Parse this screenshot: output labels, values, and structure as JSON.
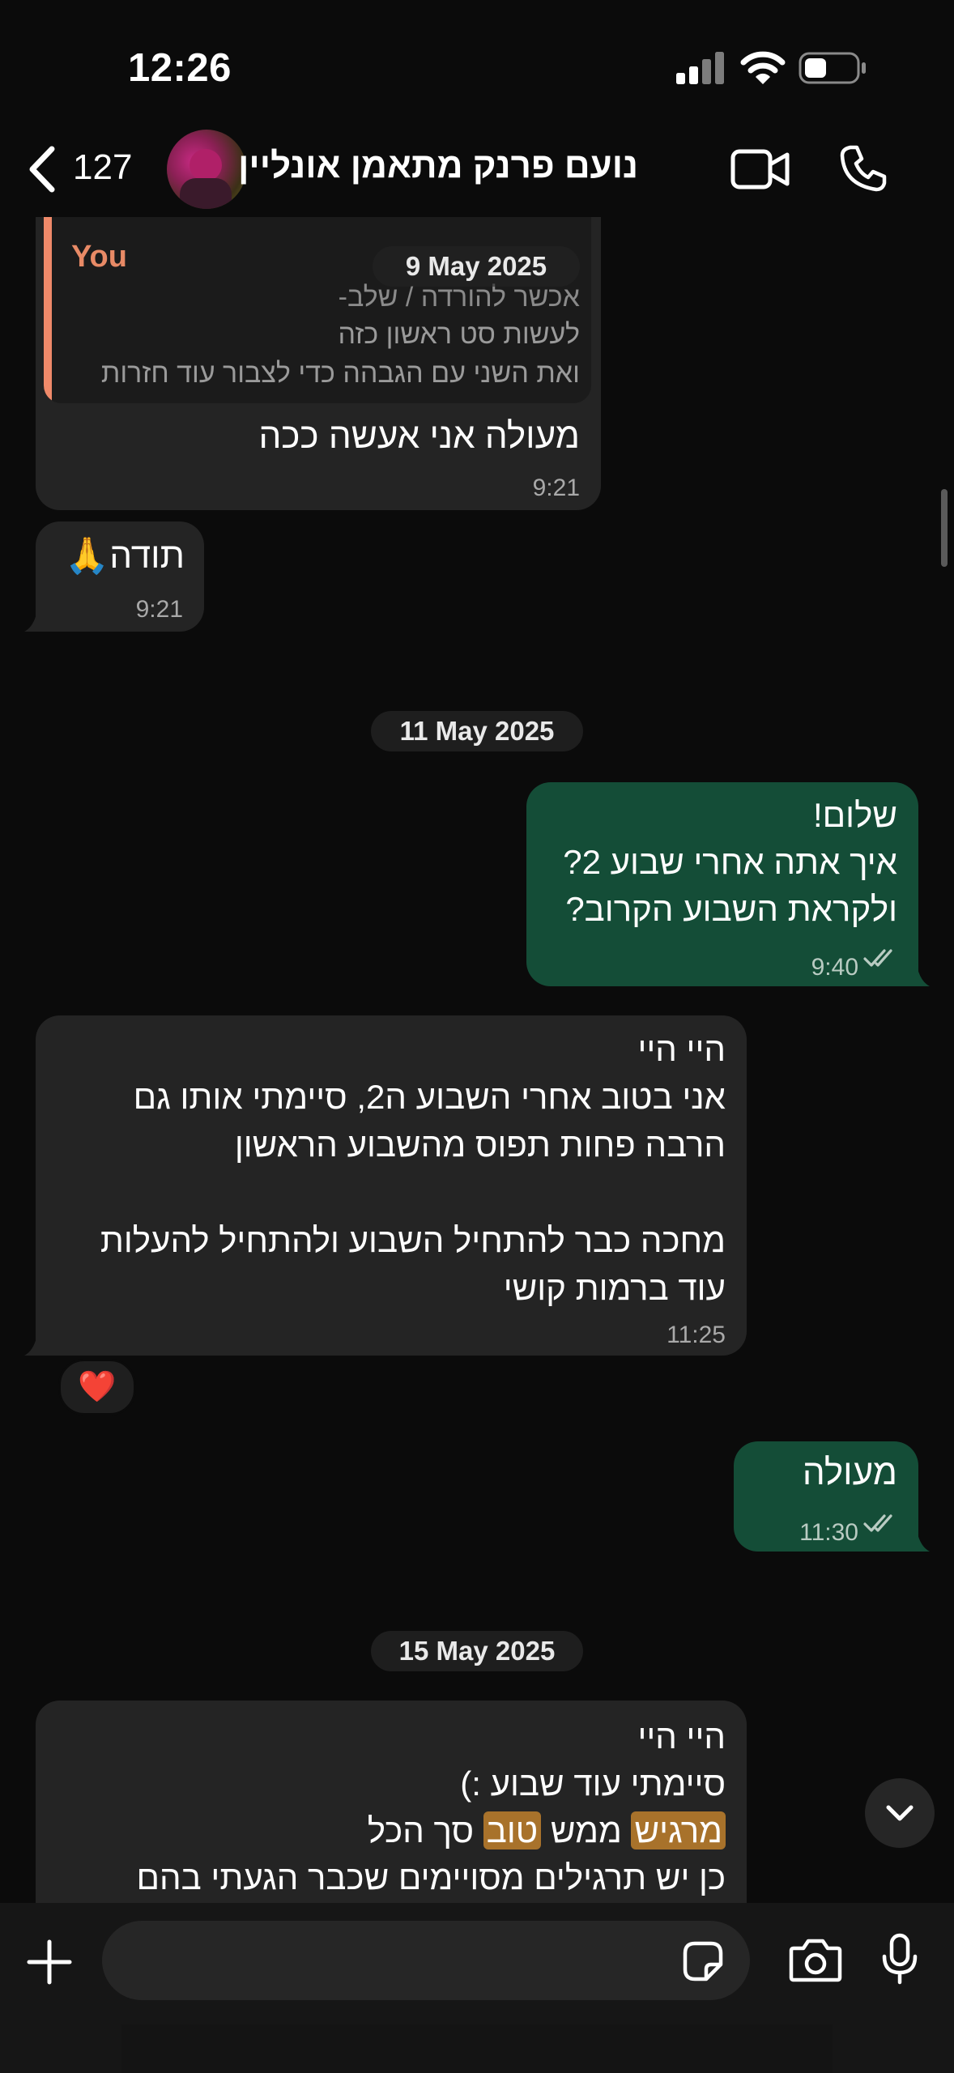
{
  "status_bar": {
    "time": "12:26"
  },
  "header": {
    "back_count": "127",
    "contact_name": "נועם פרנק מתאמן אונליין"
  },
  "chat": {
    "floating_date": "9 May 2025",
    "messages": [
      {
        "id": "m1",
        "direction": "incoming",
        "quote": {
          "author": "You",
          "lines": [
            "אכשר להורדה / שלב-",
            "לעשות סט ראשון כזה",
            "ואת השני עם הגבהה כדי לצבור עוד חזרות"
          ]
        },
        "text": "מעולה אני אעשה ככה",
        "time": "9:21"
      },
      {
        "id": "m2",
        "direction": "incoming",
        "text": "תודה🙏",
        "time": "9:21"
      },
      {
        "id": "d1",
        "type": "date",
        "text": "11 May 2025"
      },
      {
        "id": "m3",
        "direction": "outgoing",
        "text": "שלום!\nאיך אתה אחרי שבוע 2?\nולקראת השבוע הקרוב?",
        "time": "9:40",
        "status": "read"
      },
      {
        "id": "m4",
        "direction": "incoming",
        "text": "היי היי\nאני בטוב אחרי השבוע ה2, סיימתי אותו גם\nהרבה פחות תפוס מהשבוע הראשון\n\nמחכה כבר להתחיל השבוע ולהתחיל להעלות\nעוד ברמות קושי",
        "time": "11:25",
        "reaction": "❤️"
      },
      {
        "id": "m5",
        "direction": "outgoing",
        "text": "מעולה",
        "time": "11:30",
        "status": "read"
      },
      {
        "id": "d2",
        "type": "date",
        "text": "15 May 2025"
      },
      {
        "id": "m6",
        "direction": "incoming",
        "line1": "היי היי",
        "line2": "סיימתי עוד שבוע :)",
        "line3": {
          "hl1": "מרגיש",
          "mid": " ממש ",
          "hl2": "טוב",
          "tail": " סך הכל"
        },
        "line4": "כן יש תרגילים מסויימים שכבר הגעתי בהם"
      }
    ]
  },
  "input": {
    "placeholder": ""
  },
  "colors": {
    "incoming_bubble": "#242424",
    "outgoing_bubble": "#144d37",
    "quote_bar": "#f08a6a",
    "quote_author": "#e88a66",
    "highlight": "#a8722b",
    "read_ticks": "#b9cbc2"
  },
  "icons": [
    "back-chevron-icon",
    "video-call-icon",
    "phone-call-icon",
    "plus-icon",
    "sticker-icon",
    "camera-icon",
    "microphone-icon",
    "scroll-down-icon",
    "signal-icon",
    "wifi-icon",
    "battery-icon",
    "read-receipt-icon"
  ]
}
